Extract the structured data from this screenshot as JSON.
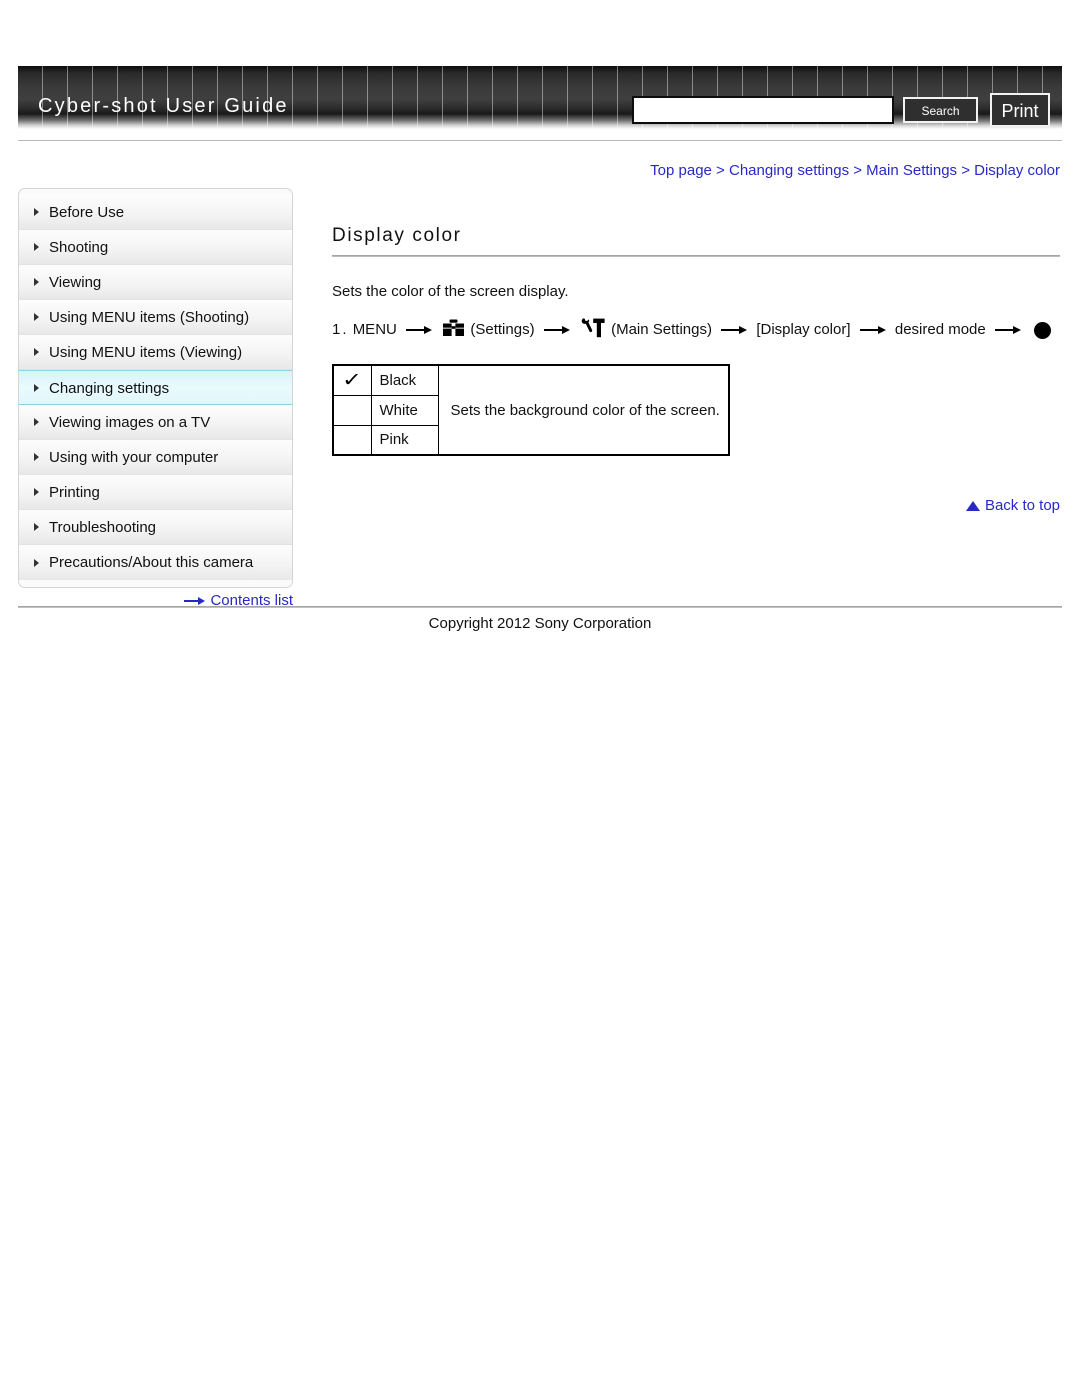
{
  "header": {
    "brand": "Cyber-shot User Guide",
    "search": {
      "value": "",
      "placeholder": ""
    },
    "search_button": "Search",
    "print_button": "Print"
  },
  "breadcrumb": {
    "items": [
      "Top page",
      "Changing settings",
      "Main Settings",
      "Display color"
    ],
    "separator": ">",
    "full": "Top page > Changing settings > Main Settings > Display color"
  },
  "sidebar": {
    "items": [
      {
        "label": "Before Use",
        "active": false
      },
      {
        "label": "Shooting",
        "active": false
      },
      {
        "label": "Viewing",
        "active": false
      },
      {
        "label": "Using MENU items (Shooting)",
        "active": false
      },
      {
        "label": "Using MENU items (Viewing)",
        "active": false
      },
      {
        "label": "Changing settings",
        "active": true
      },
      {
        "label": "Viewing images on a TV",
        "active": false
      },
      {
        "label": "Using with your computer",
        "active": false
      },
      {
        "label": "Printing",
        "active": false
      },
      {
        "label": "Troubleshooting",
        "active": false
      },
      {
        "label": "Precautions/About this camera",
        "active": false
      }
    ],
    "contents_link": "Contents list"
  },
  "main": {
    "title": "Display color",
    "intro": "Sets the color of the screen display.",
    "step": {
      "number": "1.",
      "menu_label": "MENU",
      "settings_label": "(Settings)",
      "main_settings_label": "(Main Settings)",
      "bracket_label": "[Display color]",
      "desired_mode_label": "desired mode"
    },
    "table": {
      "rows": [
        {
          "checked": true,
          "check_glyph": "✓",
          "name": "Black"
        },
        {
          "checked": false,
          "check_glyph": "",
          "name": "White"
        },
        {
          "checked": false,
          "check_glyph": "",
          "name": "Pink"
        }
      ],
      "description": "Sets the background color of the screen."
    },
    "back_to_top": "Back to top"
  },
  "footer": {
    "copyright": "Copyright 2012 Sony Corporation"
  },
  "colors": {
    "link_blue": "#2828c8",
    "active_nav": "#d6f4fa",
    "header_dark": "#2f2f2f"
  }
}
